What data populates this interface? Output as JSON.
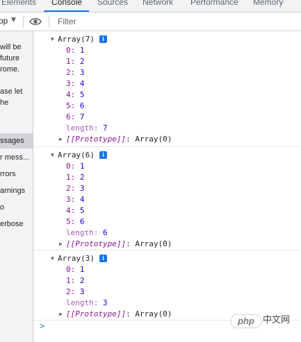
{
  "tabs": [
    {
      "label": "Elements",
      "active": false
    },
    {
      "label": "Console",
      "active": true
    },
    {
      "label": "Sources",
      "active": false
    },
    {
      "label": "Network",
      "active": false
    },
    {
      "label": "Performance",
      "active": false
    },
    {
      "label": "Memory",
      "active": false
    }
  ],
  "toolbar": {
    "context_label": "op",
    "caret_icon": "caret-down-icon",
    "eye_icon": "eye-icon",
    "filter_placeholder": "Filter"
  },
  "sidebar": {
    "warning_lines": [
      "will be",
      "future",
      "rome.",
      "",
      "ase let",
      "he"
    ],
    "items": [
      {
        "label": "ssages",
        "selected": true
      },
      {
        "label": "r mess...",
        "selected": false
      },
      {
        "label": "rrors",
        "selected": false
      },
      {
        "label": "arnings",
        "selected": false
      },
      {
        "label": "o",
        "selected": false
      },
      {
        "label": "erbose",
        "selected": false
      }
    ]
  },
  "console": {
    "groups": [
      {
        "header": "Array(7)",
        "info": "i",
        "entries": [
          {
            "key": "0",
            "value": "1"
          },
          {
            "key": "1",
            "value": "2"
          },
          {
            "key": "2",
            "value": "3"
          },
          {
            "key": "3",
            "value": "4"
          },
          {
            "key": "4",
            "value": "5"
          },
          {
            "key": "5",
            "value": "6"
          },
          {
            "key": "6",
            "value": "7"
          }
        ],
        "length_key": "length",
        "length_value": "7",
        "proto_key": "[[Prototype]]",
        "proto_value": "Array(0)"
      },
      {
        "header": "Array(6)",
        "info": "i",
        "entries": [
          {
            "key": "0",
            "value": "1"
          },
          {
            "key": "1",
            "value": "2"
          },
          {
            "key": "2",
            "value": "3"
          },
          {
            "key": "3",
            "value": "4"
          },
          {
            "key": "4",
            "value": "5"
          },
          {
            "key": "5",
            "value": "6"
          }
        ],
        "length_key": "length",
        "length_value": "6",
        "proto_key": "[[Prototype]]",
        "proto_value": "Array(0)"
      },
      {
        "header": "Array(3)",
        "info": "i",
        "entries": [
          {
            "key": "0",
            "value": "1"
          },
          {
            "key": "1",
            "value": "2"
          },
          {
            "key": "2",
            "value": "3"
          }
        ],
        "length_key": "length",
        "length_value": "3",
        "proto_key": "[[Prototype]]",
        "proto_value": "Array(0)"
      }
    ],
    "prompt_symbol": ">"
  },
  "watermark": {
    "logo_text": "php",
    "site_text": "中文网"
  },
  "colors": {
    "accent": "#1a73e8",
    "key": "#881391",
    "number": "#1c00cf",
    "length_key": "#a35cb3"
  }
}
